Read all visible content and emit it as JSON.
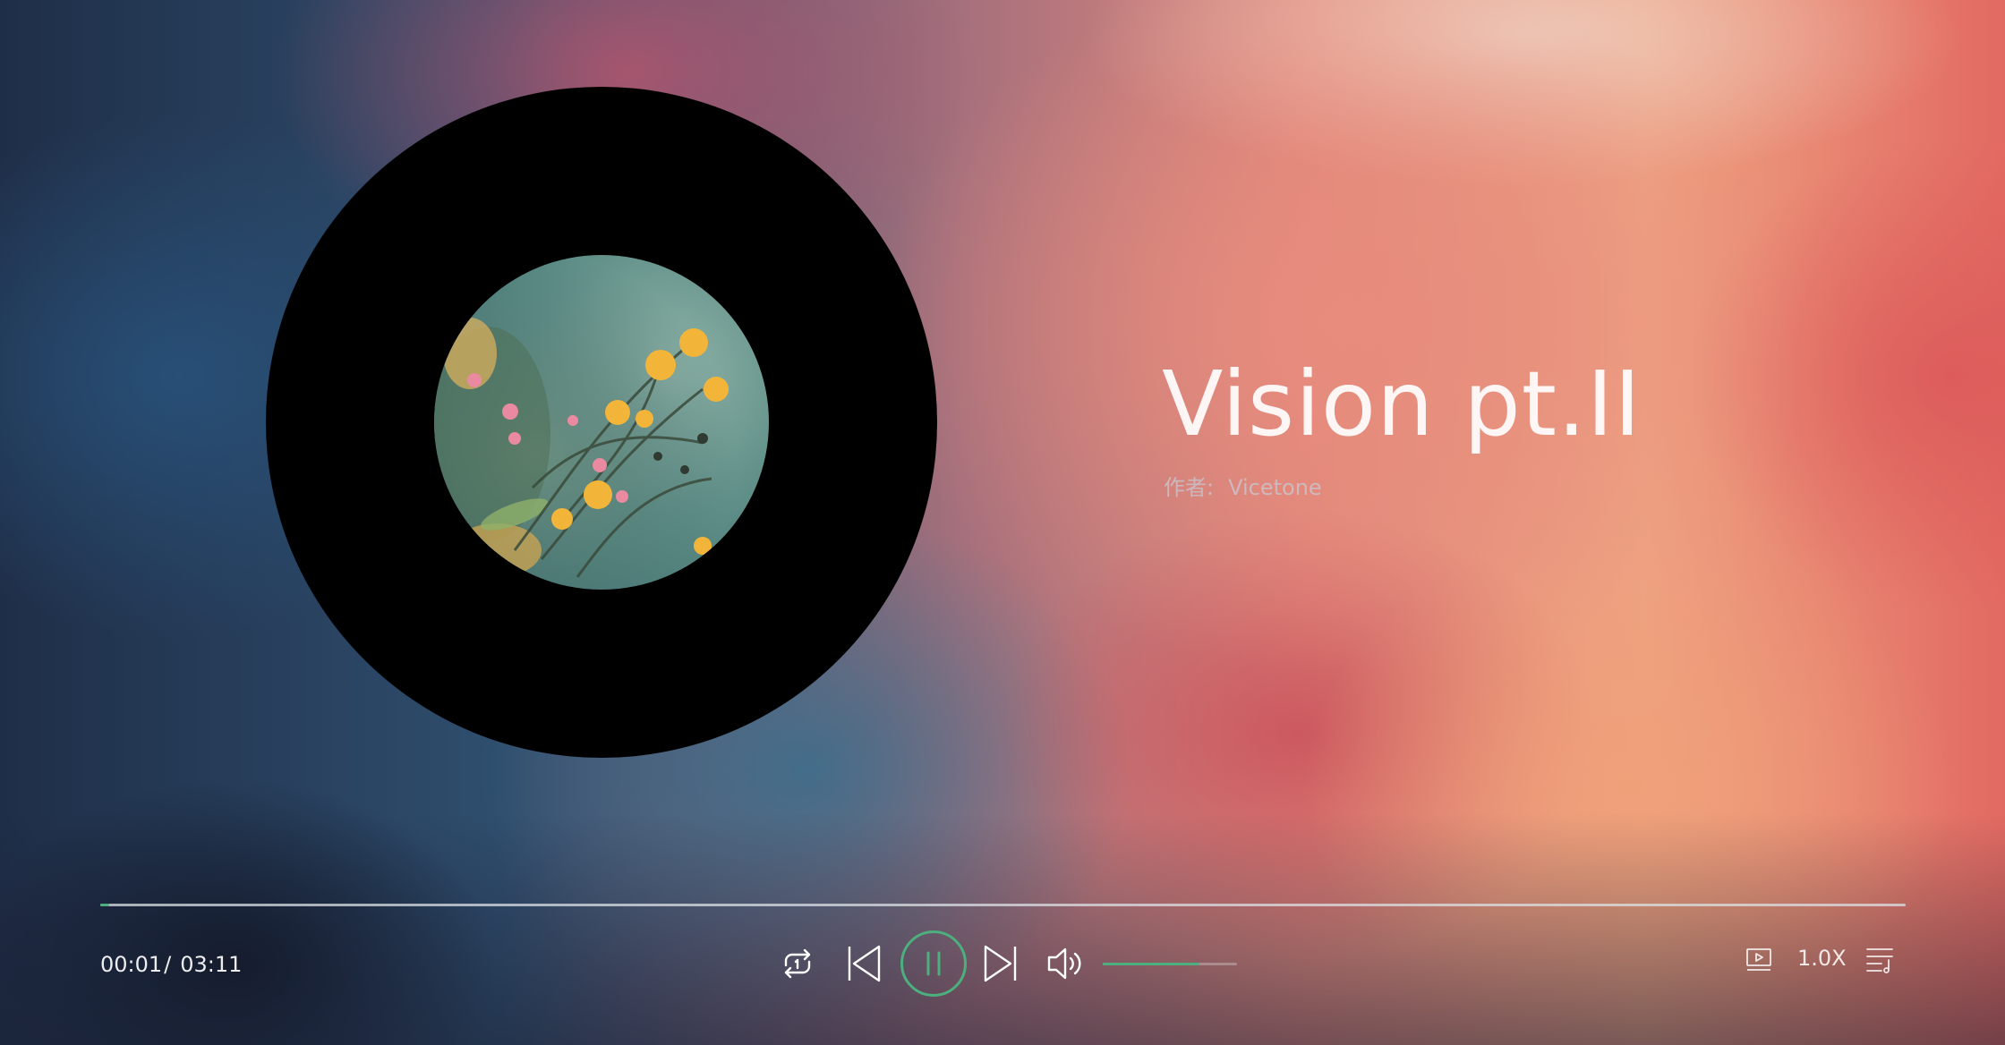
{
  "song": {
    "title": "Vision pt.II",
    "artist_label": "作者:",
    "artist": "Vicetone"
  },
  "playback": {
    "current_time": "00:01",
    "separator": "/",
    "total_time": "03:11",
    "progress_fraction": 0.005,
    "state": "playing",
    "speed": "1.0X",
    "volume_fraction": 0.72
  },
  "icons": {
    "loop": "loop-icon",
    "previous": "skip-previous-icon",
    "pause": "pause-icon",
    "next": "skip-next-icon",
    "volume": "volume-icon",
    "mv": "video-icon",
    "playlist": "playlist-icon"
  },
  "colors": {
    "accent": "#4caf7d",
    "disc": "#000000",
    "text": "#ffffff"
  }
}
